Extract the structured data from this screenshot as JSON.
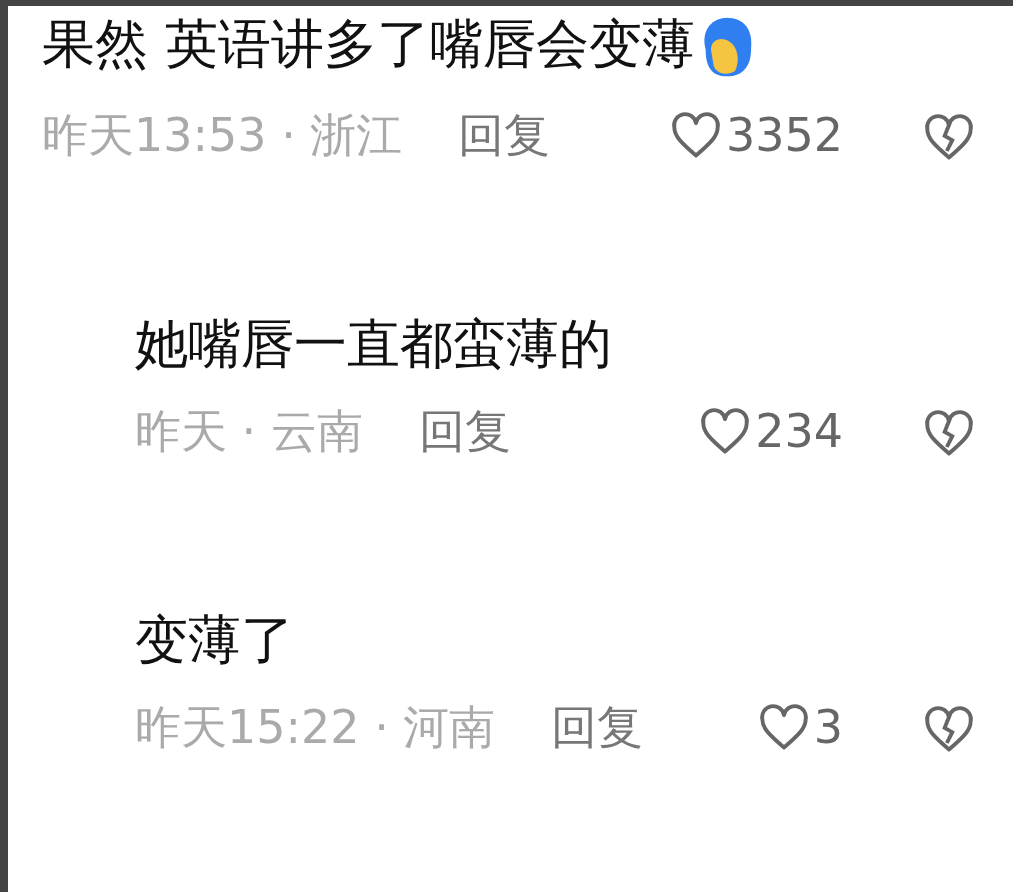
{
  "comments": [
    {
      "text": "果然 英语讲多了嘴唇会变薄",
      "emoji": true,
      "meta": "昨天13:53 · 浙江",
      "reply": "回复",
      "likes": "3352",
      "children": [
        {
          "text": "她嘴唇一直都蛮薄的",
          "emoji": false,
          "meta": "昨天 · 云南",
          "reply": "回复",
          "likes": "234"
        },
        {
          "text": "变薄了",
          "emoji": false,
          "meta": "昨天15:22 · 河南",
          "reply": "回复",
          "likes": "3"
        }
      ]
    }
  ]
}
